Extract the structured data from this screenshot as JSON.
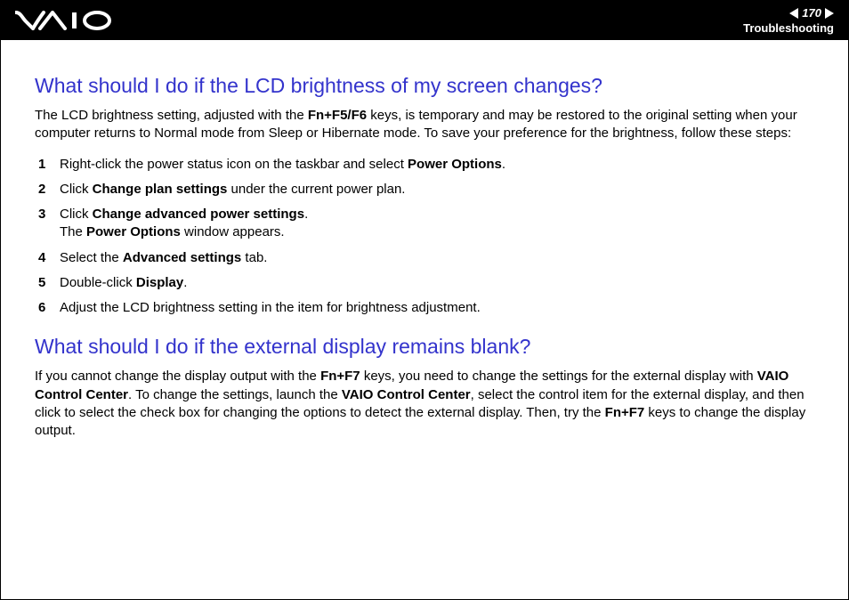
{
  "header": {
    "page_number": "170",
    "section": "Troubleshooting"
  },
  "section1": {
    "heading": "What should I do if the LCD brightness of my screen changes?",
    "intro_pre": "The LCD brightness setting, adjusted with the ",
    "intro_keys": "Fn+F5/F6",
    "intro_post": " keys, is temporary and may be restored to the original setting when your computer returns to Normal mode from Sleep or Hibernate mode. To save your preference for the brightness, follow these steps:",
    "steps": [
      {
        "num": "1",
        "pre": "Right-click the power status icon on the taskbar and select ",
        "bold": "Power Options",
        "post": "."
      },
      {
        "num": "2",
        "pre": "Click ",
        "bold": "Change plan settings",
        "post": " under the current power plan."
      },
      {
        "num": "3",
        "pre": "Click ",
        "bold": "Change advanced power settings",
        "post": ".",
        "line2_pre": "The ",
        "line2_bold": "Power Options",
        "line2_post": " window appears."
      },
      {
        "num": "4",
        "pre": "Select the ",
        "bold": "Advanced settings",
        "post": " tab."
      },
      {
        "num": "5",
        "pre": "Double-click ",
        "bold": "Display",
        "post": "."
      },
      {
        "num": "6",
        "pre": "Adjust the LCD brightness setting in the item for brightness adjustment.",
        "bold": "",
        "post": ""
      }
    ]
  },
  "section2": {
    "heading": "What should I do if the external display remains blank?",
    "p_a": "If you cannot change the display output with the ",
    "p_b": "Fn+F7",
    "p_c": " keys, you need to change the settings for the external display with ",
    "p_d": "VAIO Control Center",
    "p_e": ". To change the settings, launch the ",
    "p_f": "VAIO Control Center",
    "p_g": ", select the control item for the external display, and then click to select the check box for changing the options to detect the external display. Then, try the ",
    "p_h": "Fn+F7",
    "p_i": " keys to change the display output."
  }
}
